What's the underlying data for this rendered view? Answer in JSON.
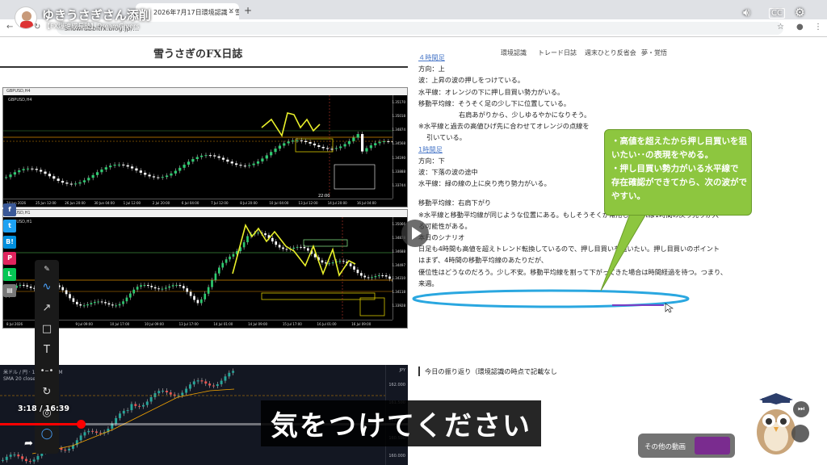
{
  "browser": {
    "tab_title": "2026年7月17日環境認識 – 雪…",
    "url": "snowrabbitfx.blog.jp/…"
  },
  "youtube": {
    "channel_title": "ゆきうさぎさん添削",
    "channel_sub": "【FX爆速成長塾】DreamGivers",
    "time_current": "3:18",
    "time_total": "16:39",
    "progress": 0.199,
    "subtitle": "気をつけてください",
    "others_label": "その他の動画"
  },
  "blog": {
    "title": "雪うさぎのFX日誌",
    "nav": [
      "環境認識",
      "トレード日誌",
      "週末ひとり反省会",
      "夢・覚悟"
    ],
    "lines": [
      {
        "text": "４時間足",
        "cls": "hl"
      },
      {
        "text": "方向：上",
        "cls": ""
      },
      {
        "text": "波：上昇の波の押しをつけている。",
        "cls": ""
      },
      {
        "text": "水平線：オレンジの下に押し目買い勢力がいる。",
        "cls": ""
      },
      {
        "text": "移動平均線：そうそく足の少し下に位置している。",
        "cls": ""
      },
      {
        "text": "右肩あがりから、少しゆるやかになりそう。",
        "cls": "indent"
      },
      {
        "text": "※水平線と過去の高値ひげ先に合わせてオレンジの点線を",
        "cls": ""
      },
      {
        "text": "引いている。",
        "cls": "indent2"
      },
      {
        "text": "1時間足",
        "cls": "hl"
      },
      {
        "text": "方向：下",
        "cls": ""
      },
      {
        "text": "波：下落の波の途中",
        "cls": ""
      },
      {
        "text": "水平線：緑の線の上に戻り売り勢力がいる。",
        "cls": ""
      },
      {
        "text": "",
        "cls": "sp"
      },
      {
        "text": "移動平均線：右肩下がり",
        "cls": ""
      },
      {
        "text": "※水平線と移動平均線が同じような位置にある。もしそうそくが常用してくれば1時間の戻り売りが入",
        "cls": ""
      },
      {
        "text": "る可能性がある。",
        "cls": ""
      },
      {
        "text": "本日のシナリオ",
        "cls": ""
      },
      {
        "text": "日足も4時間も高値を超えトレンド転換しているので、押し目買いを狙いたい。押し目買いのポイント",
        "cls": ""
      },
      {
        "text": "はまず、4時間の移動平均線のあたりだが、",
        "cls": ""
      },
      {
        "text": "優位性はどうなのだろう。少し不安。移動平均線を割って下がってきた場合は時間経過を待つ。つまり、",
        "cls": ""
      },
      {
        "text": "来週。",
        "cls": ""
      }
    ],
    "review": "今日の振り返り（環境認識の時点で記載なし"
  },
  "callout": [
    "・高値を超えたから押し目買いを狙",
    "いたい･･の表現をやめる。",
    "・押し目買い勢力がいる水平線で",
    "存在確認ができてから、次の波がで",
    "やすい。"
  ],
  "chart4h": {
    "header": "GBPUSD,H4",
    "prices": [
      "1.35170",
      "1.35018",
      "1.34874",
      "1.34568",
      "1.34190",
      "1.33888",
      "1.33744"
    ],
    "dates": [
      "24 Jun 2026",
      "25 Jun 12:00",
      "26 Jun 20:00",
      "30 Jun 04:00",
      "1 Jul 12:00",
      "2 Jul 20:00",
      "6 Jul 04:00",
      "7 Jul 12:00",
      "8 Jul 20:00",
      "10 Jul 04:00",
      "13 Jul 12:00",
      "14 Jul 20:00",
      "16 Jul 04:00"
    ],
    "close_label": "22:00"
  },
  "chart1h": {
    "header": "GBPUSD,H1",
    "prices": [
      "1.35066",
      "1.34878",
      "1.34688",
      "1.34497",
      "1.34310",
      "1.34118",
      "1.33928"
    ],
    "dates": [
      "8 Jul 2026",
      "9 Jul 01:00",
      "9 Jul 09:00",
      "10 Jul 17:00",
      "10 Jul 09:00",
      "13 Jul 17:00",
      "14 Jul 01:00",
      "14 Jul 09:00",
      "15 Jul 17:00",
      "16 Jul 01:00",
      "16 Jul 09:00"
    ]
  },
  "tv": {
    "symbol_line": "米ドル / 円 · 1時間 · FXCM",
    "ma_label": "SMA 20 close",
    "prices": [
      "162.000",
      "161.500",
      "161.000",
      "160.500",
      "160.000"
    ],
    "currency": "JPY"
  },
  "colors": {
    "callout": "#8dc63f",
    "highlight_ellipse": "#2aa7e0",
    "progress": "#ff0000",
    "share": [
      "#3b5998",
      "#1da1f2",
      "#008fde",
      "#e0245e",
      "#06c755",
      "#777777"
    ]
  }
}
